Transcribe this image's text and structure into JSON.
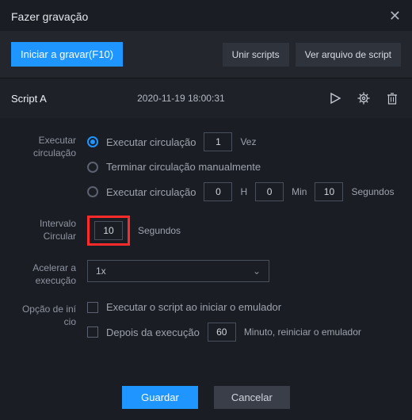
{
  "window": {
    "title": "Fazer gravação"
  },
  "toolbar": {
    "start_record": "Iniciar a gravar(F10)",
    "merge_scripts": "Unir scripts",
    "view_script_file": "Ver arquivo de script"
  },
  "script": {
    "name": "Script A",
    "timestamp": "2020-11-19 18:00:31"
  },
  "form": {
    "loop_label": "Executar circulação",
    "opt_loop_times_label": "Executar circulação",
    "opt_loop_times_value": "1",
    "opt_loop_times_unit": "Vez",
    "opt_loop_manual_label": "Terminar circulação manualmente",
    "opt_loop_duration_label": "Executar circulação",
    "dur_h": "0",
    "dur_h_unit": "H",
    "dur_m": "0",
    "dur_m_unit": "Min",
    "dur_s": "10",
    "dur_s_unit": "Segundos",
    "interval_label": "Intervalo Circular",
    "interval_value": "10",
    "interval_unit": "Segundos",
    "speed_label": "Acelerar a execução",
    "speed_value": "1x",
    "startup_label": "Opção de iní\ncio",
    "startup_run_label": "Executar o script ao iniciar o emulador",
    "startup_after_label": "Depois da execução",
    "startup_after_value": "60",
    "startup_after_unit": "Minuto, reiniciar o emulador"
  },
  "footer": {
    "save": "Guardar",
    "cancel": "Cancelar"
  }
}
